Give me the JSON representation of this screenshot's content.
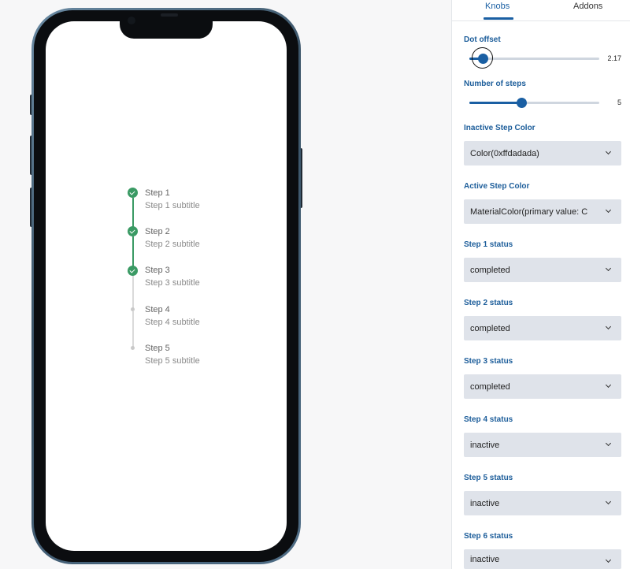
{
  "panel": {
    "tabs": [
      {
        "label": "Knobs",
        "active": true
      },
      {
        "label": "Addons",
        "active": false
      }
    ],
    "dot_offset": {
      "label": "Dot offset",
      "value": "2.17",
      "fraction": 0.1
    },
    "number_of_steps": {
      "label": "Number of steps",
      "value": "5",
      "fraction": 0.4
    },
    "inactive_color": {
      "label": "Inactive Step Color",
      "value": "Color(0xffdadada)"
    },
    "active_color": {
      "label": "Active Step Color",
      "value": "MaterialColor(primary value: C"
    },
    "step_statuses": [
      {
        "label": "Step 1 status",
        "value": "completed"
      },
      {
        "label": "Step 2 status",
        "value": "completed"
      },
      {
        "label": "Step 3 status",
        "value": "completed"
      },
      {
        "label": "Step 4 status",
        "value": "inactive"
      },
      {
        "label": "Step 5 status",
        "value": "inactive"
      },
      {
        "label": "Step 6 status",
        "value": "inactive"
      }
    ]
  },
  "stepper": {
    "active_color": "#3a9a64",
    "inactive_color": "#dadada",
    "steps": [
      {
        "title": "Step 1",
        "subtitle": "Step 1 subtitle",
        "status": "completed"
      },
      {
        "title": "Step 2",
        "subtitle": "Step 2 subtitle",
        "status": "completed"
      },
      {
        "title": "Step 3",
        "subtitle": "Step 3 subtitle",
        "status": "completed"
      },
      {
        "title": "Step 4",
        "subtitle": "Step 4 subtitle",
        "status": "inactive"
      },
      {
        "title": "Step 5",
        "subtitle": "Step 5 subtitle",
        "status": "inactive"
      }
    ]
  }
}
